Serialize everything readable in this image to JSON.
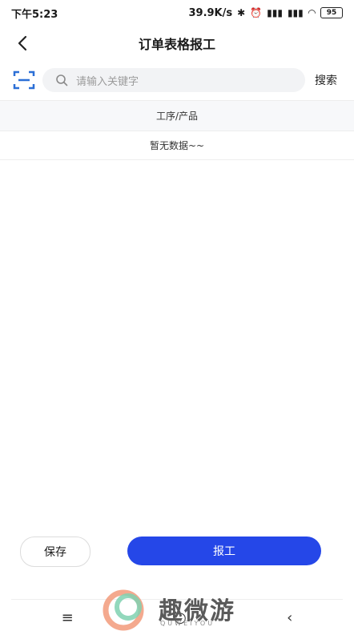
{
  "status": {
    "time": "下午5:23",
    "network_speed": "39.9K/s",
    "battery": "95"
  },
  "nav": {
    "title": "订单表格报工"
  },
  "search": {
    "placeholder": "请输入关键字",
    "button_label": "搜索"
  },
  "table": {
    "header": "工序/产品",
    "empty_text": "暂无数据~~"
  },
  "actions": {
    "save_label": "保存",
    "report_label": "报工",
    "accent_color": "#2547e8"
  },
  "watermark": {
    "name": "趣微游",
    "sub": "QUWEIYOU"
  },
  "icons": {
    "back": "chevron-left-icon",
    "scan": "scan-icon",
    "search": "search-icon"
  }
}
